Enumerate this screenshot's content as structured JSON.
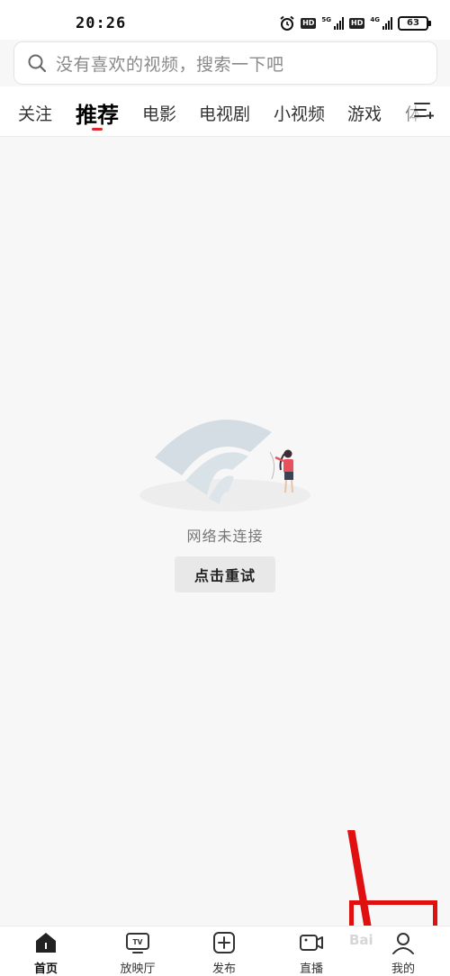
{
  "status_bar": {
    "time": "20:26",
    "hd_badge": "HD",
    "net1": "5G",
    "net2": "4G",
    "battery": "63"
  },
  "search": {
    "placeholder": "没有喜欢的视频，搜索一下吧",
    "icon": "search-icon"
  },
  "tabs": [
    {
      "label": "关注"
    },
    {
      "label": "推荐",
      "active": true
    },
    {
      "label": "电影"
    },
    {
      "label": "电视剧"
    },
    {
      "label": "小视频"
    },
    {
      "label": "游戏"
    },
    {
      "label": "体"
    }
  ],
  "accent_color": "#e0262c",
  "content": {
    "error_message": "网络未连接",
    "retry_label": "点击重试"
  },
  "bottom_nav": [
    {
      "label": "首页",
      "icon": "home-icon",
      "active": true
    },
    {
      "label": "放映厅",
      "icon": "tv-icon"
    },
    {
      "label": "发布",
      "icon": "plus-icon"
    },
    {
      "label": "直播",
      "icon": "live-camera-icon"
    },
    {
      "label": "我的",
      "icon": "profile-icon"
    }
  ],
  "watermark": "Bai"
}
